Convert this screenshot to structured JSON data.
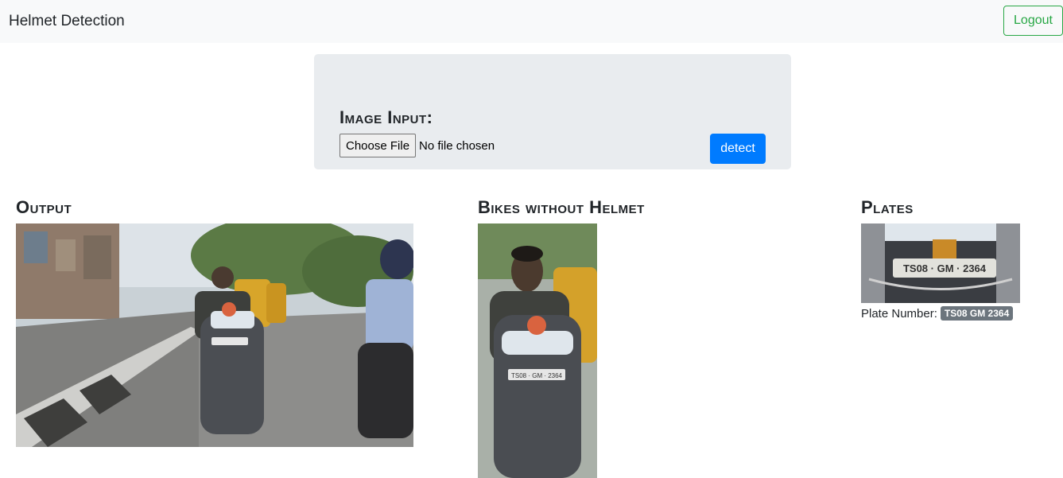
{
  "navbar": {
    "brand": "Helmet Detection",
    "logout_label": "Logout"
  },
  "input_card": {
    "title": "Image Input:",
    "choose_file_label": "Choose File",
    "no_file_text": "No file chosen",
    "detect_label": "detect"
  },
  "sections": {
    "output_title": "Output",
    "bikes_title": "Bikes without Helmet",
    "plates_title": "Plates"
  },
  "plates": {
    "plate_label": "Plate Number:",
    "plate_number": "TS08 GM 2364",
    "image_plate_text": "TS08 · GM · 2364"
  },
  "colors": {
    "navbar_bg": "#f8f9fa",
    "card_bg": "#e9ecef",
    "logout_accent": "#28a745",
    "detect_btn": "#007bff",
    "badge_bg": "#6c757d"
  }
}
